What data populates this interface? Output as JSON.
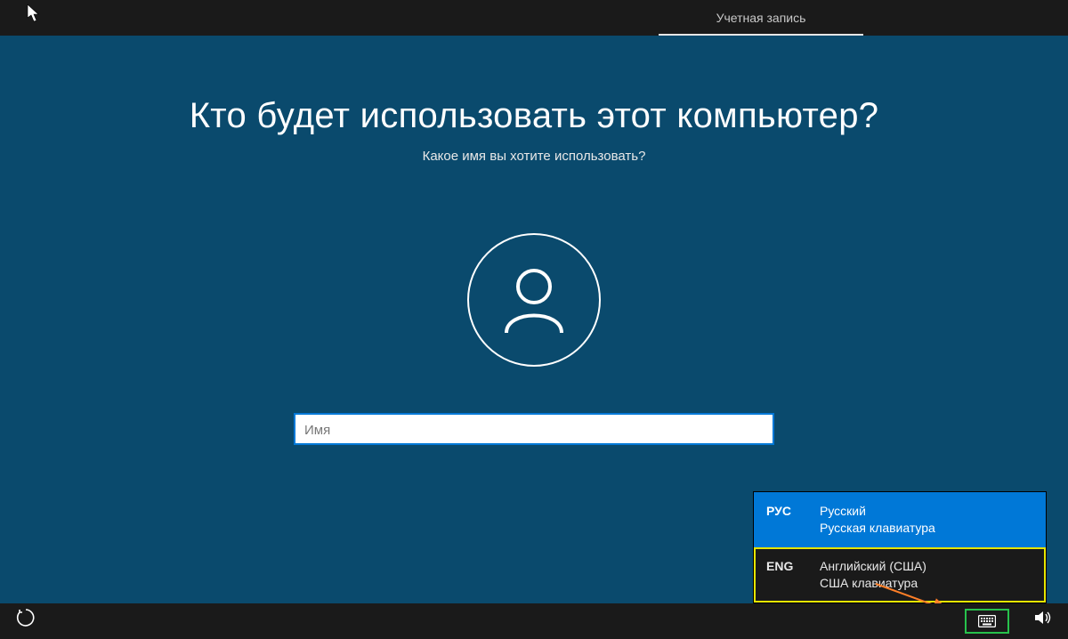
{
  "topbar": {
    "tab_label": "Учетная запись"
  },
  "main": {
    "heading": "Кто будет использовать этот компьютер?",
    "subheading": "Какое имя вы хотите использовать?",
    "name_placeholder": "Имя"
  },
  "lang_popup": {
    "items": [
      {
        "code": "РУС",
        "name": "Русский",
        "layout": "Русская клавиатура",
        "selected": true,
        "highlight": false
      },
      {
        "code": "ENG",
        "name": "Английский (США)",
        "layout": "США клавиатура",
        "selected": false,
        "highlight": true
      }
    ]
  }
}
